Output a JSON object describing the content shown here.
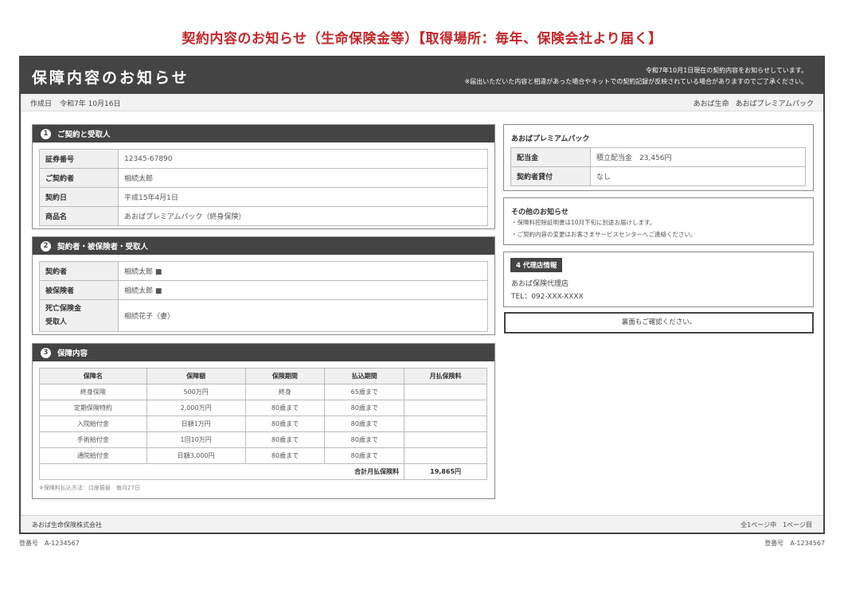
{
  "page_heading": "契約内容のお知らせ（生命保険金等）【取得場所：毎年、保険会社より届く】",
  "document": {
    "title": "保障内容のお知らせ",
    "notice_line1": "令和7年10月1日現在の契約内容をお知らせしています。",
    "notice_line2": "※届出いただいた内容と相違があった場合やネットでの契約記録が反映されている場合がありますのでご了承ください。",
    "created_label": "作成日",
    "created_date": "令和7年 10月16日",
    "company_short": "あおば生命",
    "product_short": "あおばプレミアムパック"
  },
  "section1": {
    "number": "1",
    "title": "ご契約と受取人",
    "rows": [
      {
        "label": "証券番号",
        "value": "12345-67890"
      },
      {
        "label": "ご契約者",
        "value": "相続太郎"
      },
      {
        "label": "契約日",
        "value": "平成15年4月1日"
      },
      {
        "label": "商品名",
        "value": "あおばプレミアムパック（終身保険）"
      }
    ]
  },
  "section2": {
    "number": "2",
    "title": "契約者・被保険者・受取人",
    "rows": [
      {
        "label": "契約者",
        "value": "相続太郎 ■"
      },
      {
        "label": "被保険者",
        "value": "相続太郎 ■"
      },
      {
        "label": "死亡保険金",
        "label2": "受取人",
        "value": "相続花子（妻）"
      }
    ]
  },
  "section3": {
    "number": "3",
    "title": "保障内容",
    "headers": [
      "保障名",
      "保障額",
      "保険期間",
      "払込期間",
      "月払保険料"
    ],
    "rows": [
      [
        "終身保険",
        "500万円",
        "終身",
        "65歳まで",
        ""
      ],
      [
        "定期保険特約",
        "2,000万円",
        "80歳まで",
        "80歳まで",
        ""
      ],
      [
        "入院給付金",
        "日額1万円",
        "80歳まで",
        "80歳まで",
        ""
      ],
      [
        "手術給付金",
        "1回10万円",
        "80歳まで",
        "80歳まで",
        ""
      ],
      [
        "通院給付金",
        "日額3,000円",
        "80歳まで",
        "80歳まで",
        ""
      ]
    ],
    "total_label": "合計月払保険料",
    "total_value": "19,865円",
    "note": "※保険料払込方法：口座振替　毎月27日"
  },
  "premium_pack": {
    "title": "あおばプレミアムパック",
    "rows": [
      {
        "label": "配当金",
        "value": "積立配当金　23,456円"
      },
      {
        "label": "契約者貸付",
        "value": "なし"
      }
    ]
  },
  "other_notice": {
    "title": "その他のお知らせ",
    "lines": [
      "・保険料控除証明書は10月下旬に別途お届けします。",
      "・ご契約内容の変更はお客さまサービスセンターへご連絡ください。"
    ]
  },
  "agent": {
    "label": "4 代理店情報",
    "name": "あおば保険代理店",
    "tel": "TEL：092-XXX-XXXX"
  },
  "confirm_text": "裏面もご確認ください。",
  "footer": {
    "company": "あおば生命保険株式会社",
    "page_info": "全1ページ中　1ページ目"
  },
  "bottom_ids": {
    "label": "登番号",
    "value": "A-1234567"
  }
}
